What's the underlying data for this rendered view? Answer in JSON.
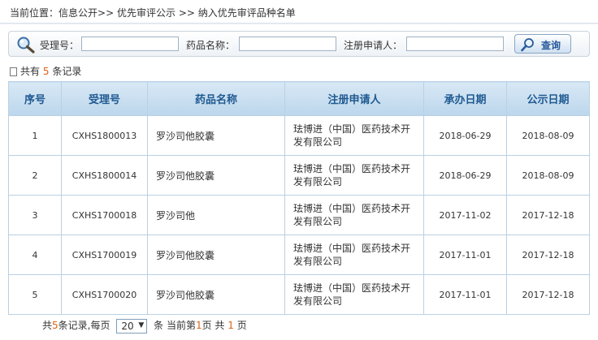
{
  "breadcrumb": {
    "prefix": "当前位置：",
    "items": [
      "信息公开",
      "优先审评公示",
      "纳入优先审评品种名单"
    ],
    "sep": ">>"
  },
  "search": {
    "fields": [
      {
        "label": "受理号：",
        "value": ""
      },
      {
        "label": "药品名称：",
        "value": ""
      },
      {
        "label": "注册申请人：",
        "value": ""
      }
    ],
    "button": "查询"
  },
  "total": {
    "prefix": "共有",
    "count": "5",
    "suffix": "条记录"
  },
  "table": {
    "headers": [
      "序号",
      "受理号",
      "药品名称",
      "注册申请人",
      "承办日期",
      "公示日期"
    ],
    "rows": [
      [
        "1",
        "CXHS1800013",
        "罗沙司他胶囊",
        "珐博进（中国）医药技术开发有限公司",
        "2018-06-29",
        "2018-08-09"
      ],
      [
        "2",
        "CXHS1800014",
        "罗沙司他胶囊",
        "珐博进（中国）医药技术开发有限公司",
        "2018-06-29",
        "2018-08-09"
      ],
      [
        "3",
        "CXHS1700018",
        "罗沙司他",
        "珐博进（中国）医药技术开发有限公司",
        "2017-11-02",
        "2017-12-18"
      ],
      [
        "4",
        "CXHS1700019",
        "罗沙司他胶囊",
        "珐博进（中国）医药技术开发有限公司",
        "2017-11-01",
        "2017-12-18"
      ],
      [
        "5",
        "CXHS1700020",
        "罗沙司他胶囊",
        "珐博进（中国）医药技术开发有限公司",
        "2017-11-01",
        "2017-12-18"
      ]
    ]
  },
  "pager": {
    "total_prefix": "共",
    "total_count": "5",
    "total_suffix": "条记录,每页",
    "page_size": "20",
    "mid": "条 当前第",
    "current": "1",
    "pages_label": "页 共",
    "page_count": "1",
    "end": "页"
  },
  "colors": {
    "accent": "#1f5a91",
    "highlight": "#e06010",
    "header_bg": "#c8def0",
    "border": "#b9d1e4"
  },
  "icons": {
    "search": "magnifier-icon",
    "query": "magnifier-icon",
    "record": "document-icon",
    "dropdown": "chevron-down-icon"
  }
}
